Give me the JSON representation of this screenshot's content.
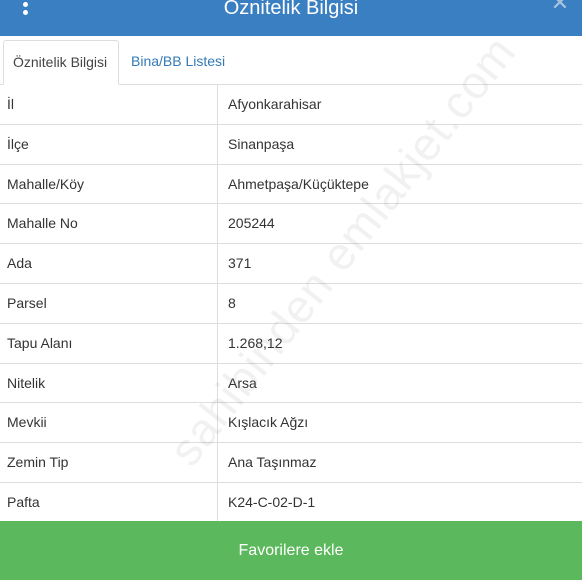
{
  "header": {
    "title": "Öznitelik Bilgisi",
    "menu_icon": "vertical-dots-icon",
    "close_icon": "close-icon",
    "color": "#3a7fc1"
  },
  "tabs": [
    {
      "label": "Öznitelik Bilgisi",
      "active": true
    },
    {
      "label": "Bina/BB Listesi",
      "active": false
    }
  ],
  "rows": [
    {
      "label": "İl",
      "value": "Afyonkarahisar"
    },
    {
      "label": "İlçe",
      "value": "Sinanpaşa"
    },
    {
      "label": "Mahalle/Köy",
      "value": "Ahmetpaşa/Küçüktepe"
    },
    {
      "label": "Mahalle No",
      "value": "205244"
    },
    {
      "label": "Ada",
      "value": "371"
    },
    {
      "label": "Parsel",
      "value": "8"
    },
    {
      "label": "Tapu Alanı",
      "value": "1.268,12"
    },
    {
      "label": "Nitelik",
      "value": "Arsa"
    },
    {
      "label": "Mevkii",
      "value": "Kışlacık Ağzı"
    },
    {
      "label": "Zemin Tip",
      "value": "Ana Taşınmaz"
    },
    {
      "label": "Pafta",
      "value": "K24-C-02-D-1"
    }
  ],
  "watermark": "sahibinden emlakjet.com",
  "favorite_button": {
    "label": "Favorilere ekle",
    "color": "#5cb85c"
  }
}
